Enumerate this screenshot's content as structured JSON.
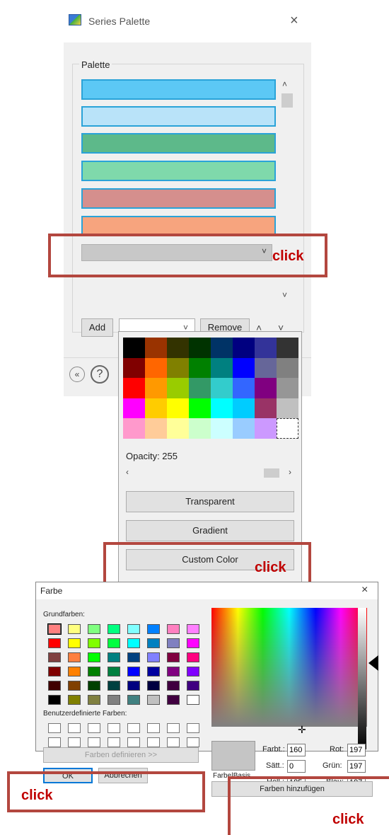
{
  "series_palette": {
    "title": "Series Palette",
    "group_label": "Palette",
    "swatches": [
      "#5cc8f5",
      "#b9e3f9",
      "#5db98a",
      "#7fd9ab",
      "#d58f8d",
      "#f7a47e"
    ],
    "add_label": "Add",
    "remove_label": "Remove",
    "close_glyph": "×",
    "icon": "app-icon"
  },
  "color_dropdown": {
    "colors": [
      "#000000",
      "#993300",
      "#333300",
      "#003300",
      "#003366",
      "#000080",
      "#333399",
      "#333333",
      "#800000",
      "#ff6600",
      "#808000",
      "#008000",
      "#008080",
      "#0000ff",
      "#666699",
      "#808080",
      "#ff0000",
      "#ff9900",
      "#99cc00",
      "#339966",
      "#33cccc",
      "#3366ff",
      "#800080",
      "#969696",
      "#ff00ff",
      "#ffcc00",
      "#ffff00",
      "#00ff00",
      "#00ffff",
      "#00ccff",
      "#993366",
      "#c0c0c0",
      "#ff99cc",
      "#ffcc99",
      "#ffff99",
      "#ccffcc",
      "#ccffff",
      "#99ccff",
      "#cc99ff",
      "#ffffff"
    ],
    "opacity_label": "Opacity: 255",
    "transparent_label": "Transparent",
    "gradient_label": "Gradient",
    "custom_color_label": "Custom Color"
  },
  "annotations": {
    "click": "click",
    "highlight_color": "#b3473f",
    "text_color": "#c00000"
  },
  "farbe_dialog": {
    "title": "Farbe",
    "basic_label": "Grundfarben:",
    "basic_colors": [
      "#ff8080",
      "#ffff80",
      "#80ff80",
      "#00ff80",
      "#80ffff",
      "#0080ff",
      "#ff80c0",
      "#ff80ff",
      "#ff0000",
      "#ffff00",
      "#80ff00",
      "#00ff40",
      "#00ffff",
      "#0080c0",
      "#8080c0",
      "#ff00ff",
      "#804040",
      "#ff8040",
      "#00ff00",
      "#008080",
      "#004080",
      "#8080ff",
      "#800040",
      "#ff0080",
      "#800000",
      "#ff8000",
      "#008000",
      "#008040",
      "#0000ff",
      "#0000a0",
      "#800080",
      "#8000ff",
      "#400000",
      "#804000",
      "#004000",
      "#004040",
      "#000080",
      "#000040",
      "#400040",
      "#400080",
      "#000000",
      "#808000",
      "#808040",
      "#808080",
      "#408080",
      "#c0c0c0",
      "#400040",
      "#ffffff"
    ],
    "custom_label": "Benutzerdefinierte Farben:",
    "define_label": "Farben definieren >>",
    "ok_label": "OK",
    "cancel_label": "Abbrechen",
    "preview_label": "Farbe|Basis",
    "add_colors_label": "Farben hinzufügen",
    "fields": {
      "farbt_label": "Farbt.:",
      "farbt_value": "160",
      "saett_label": "Sätt.:",
      "saett_value": "0",
      "hell_label": "Hell.:",
      "hell_value": "185",
      "rot_label": "Rot:",
      "rot_value": "197",
      "gruen_label": "Grün:",
      "gruen_value": "197",
      "blau_label": "Blau:",
      "blau_value": "197"
    },
    "close_glyph": "×"
  }
}
